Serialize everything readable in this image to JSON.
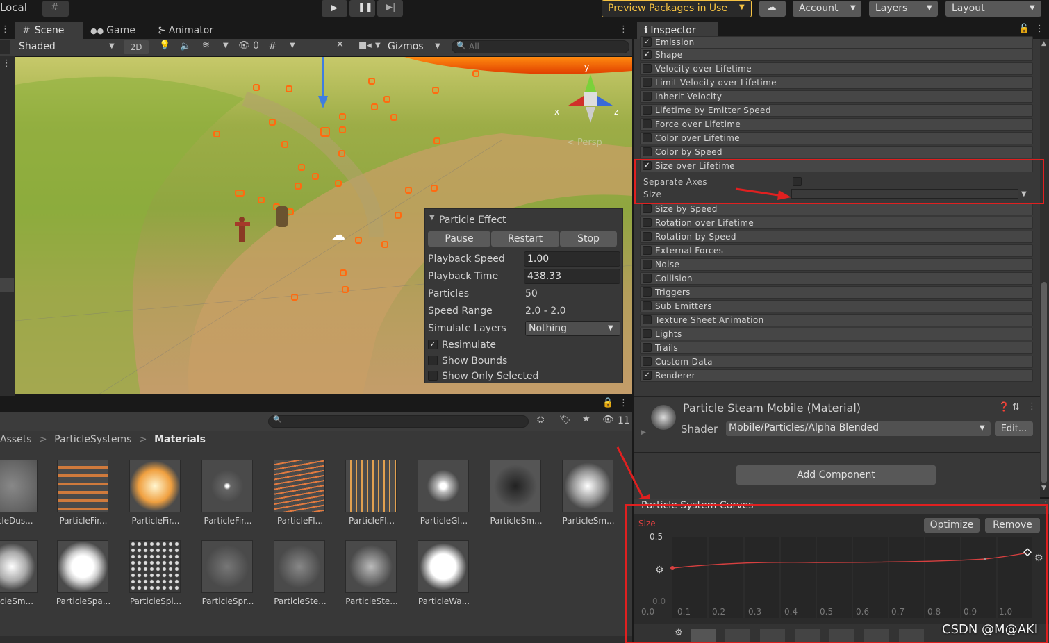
{
  "topbar": {
    "local": "Local",
    "preview": "Preview Packages in Use",
    "account": "Account",
    "layers": "Layers",
    "layout": "Layout"
  },
  "scene_tabs": {
    "scene": "Scene",
    "game": "Game",
    "animator": "Animator"
  },
  "scene_toolbar": {
    "shaded": "Shaded",
    "two_d": "2D",
    "hidden_count": "0",
    "gizmos": "Gizmos",
    "search_placeholder": "All"
  },
  "gizmo": {
    "y": "y",
    "x": "x",
    "z": "z",
    "persp": "< Persp"
  },
  "particle_effect": {
    "title": "Particle Effect",
    "pause": "Pause",
    "restart": "Restart",
    "stop": "Stop",
    "rows": [
      {
        "label": "Playback Speed",
        "value": "1.00"
      },
      {
        "label": "Playback Time",
        "value": "438.33"
      },
      {
        "label": "Particles",
        "value": "50"
      },
      {
        "label": "Speed Range",
        "value": "2.0 - 2.0"
      },
      {
        "label": "Simulate Layers",
        "value": "Nothing"
      }
    ],
    "resimulate": "Resimulate",
    "show_bounds": "Show Bounds",
    "show_only_selected": "Show Only Selected"
  },
  "inspector": {
    "tab": "Inspector",
    "modules": [
      {
        "name": "Emission",
        "checked": true
      },
      {
        "name": "Shape",
        "checked": true
      },
      {
        "name": "Velocity over Lifetime",
        "checked": false
      },
      {
        "name": "Limit Velocity over Lifetime",
        "checked": false
      },
      {
        "name": "Inherit Velocity",
        "checked": false
      },
      {
        "name": "Lifetime by Emitter Speed",
        "checked": false
      },
      {
        "name": "Force over Lifetime",
        "checked": false
      },
      {
        "name": "Color over Lifetime",
        "checked": false
      },
      {
        "name": "Color by Speed",
        "checked": false
      },
      {
        "name": "Size over Lifetime",
        "checked": true
      }
    ],
    "sol_separate_axes": "Separate Axes",
    "sol_size": "Size",
    "modules2": [
      {
        "name": "Size by Speed",
        "checked": false
      },
      {
        "name": "Rotation over Lifetime",
        "checked": false
      },
      {
        "name": "Rotation by Speed",
        "checked": false
      },
      {
        "name": "External Forces",
        "checked": false
      },
      {
        "name": "Noise",
        "checked": false
      },
      {
        "name": "Collision",
        "checked": false
      },
      {
        "name": "Triggers",
        "checked": false
      },
      {
        "name": "Sub Emitters",
        "checked": false
      },
      {
        "name": "Texture Sheet Animation",
        "checked": false
      },
      {
        "name": "Lights",
        "checked": false
      },
      {
        "name": "Trails",
        "checked": false
      },
      {
        "name": "Custom Data",
        "checked": false
      },
      {
        "name": "Renderer",
        "checked": true
      }
    ],
    "material_title": "Particle Steam Mobile (Material)",
    "shader_label": "Shader",
    "shader_value": "Mobile/Particles/Alpha Blended",
    "edit": "Edit...",
    "add_component": "Add Component"
  },
  "project": {
    "hidden_count": "11",
    "breadcrumb": [
      "Assets",
      "ParticleSystems",
      "Materials"
    ],
    "row1": [
      "icleDus...",
      "ParticleFir...",
      "ParticleFir...",
      "ParticleFir...",
      "ParticleFl...",
      "ParticleFl...",
      "ParticleGl...",
      "ParticleSm...",
      "ParticleSm..."
    ],
    "row2": [
      "ticleSm...",
      "ParticleSpa...",
      "ParticleSpl...",
      "ParticleSpr...",
      "ParticleSte...",
      "ParticleSte...",
      "ParticleWa..."
    ]
  },
  "curves": {
    "title": "Particle System Curves",
    "optimize": "Optimize",
    "remove": "Remove",
    "curve_name": "Size",
    "y_top": "0.5",
    "y_bottom": "0.0",
    "x_ticks": [
      "0.0",
      "0.1",
      "0.2",
      "0.3",
      "0.4",
      "0.5",
      "0.6",
      "0.7",
      "0.8",
      "0.9",
      "1.0"
    ]
  },
  "watermark": "CSDN @M@AKI",
  "colors": {
    "accent_yellow": "#f6c343",
    "highlight_red": "#e02020",
    "curve_red": "#d84040"
  }
}
